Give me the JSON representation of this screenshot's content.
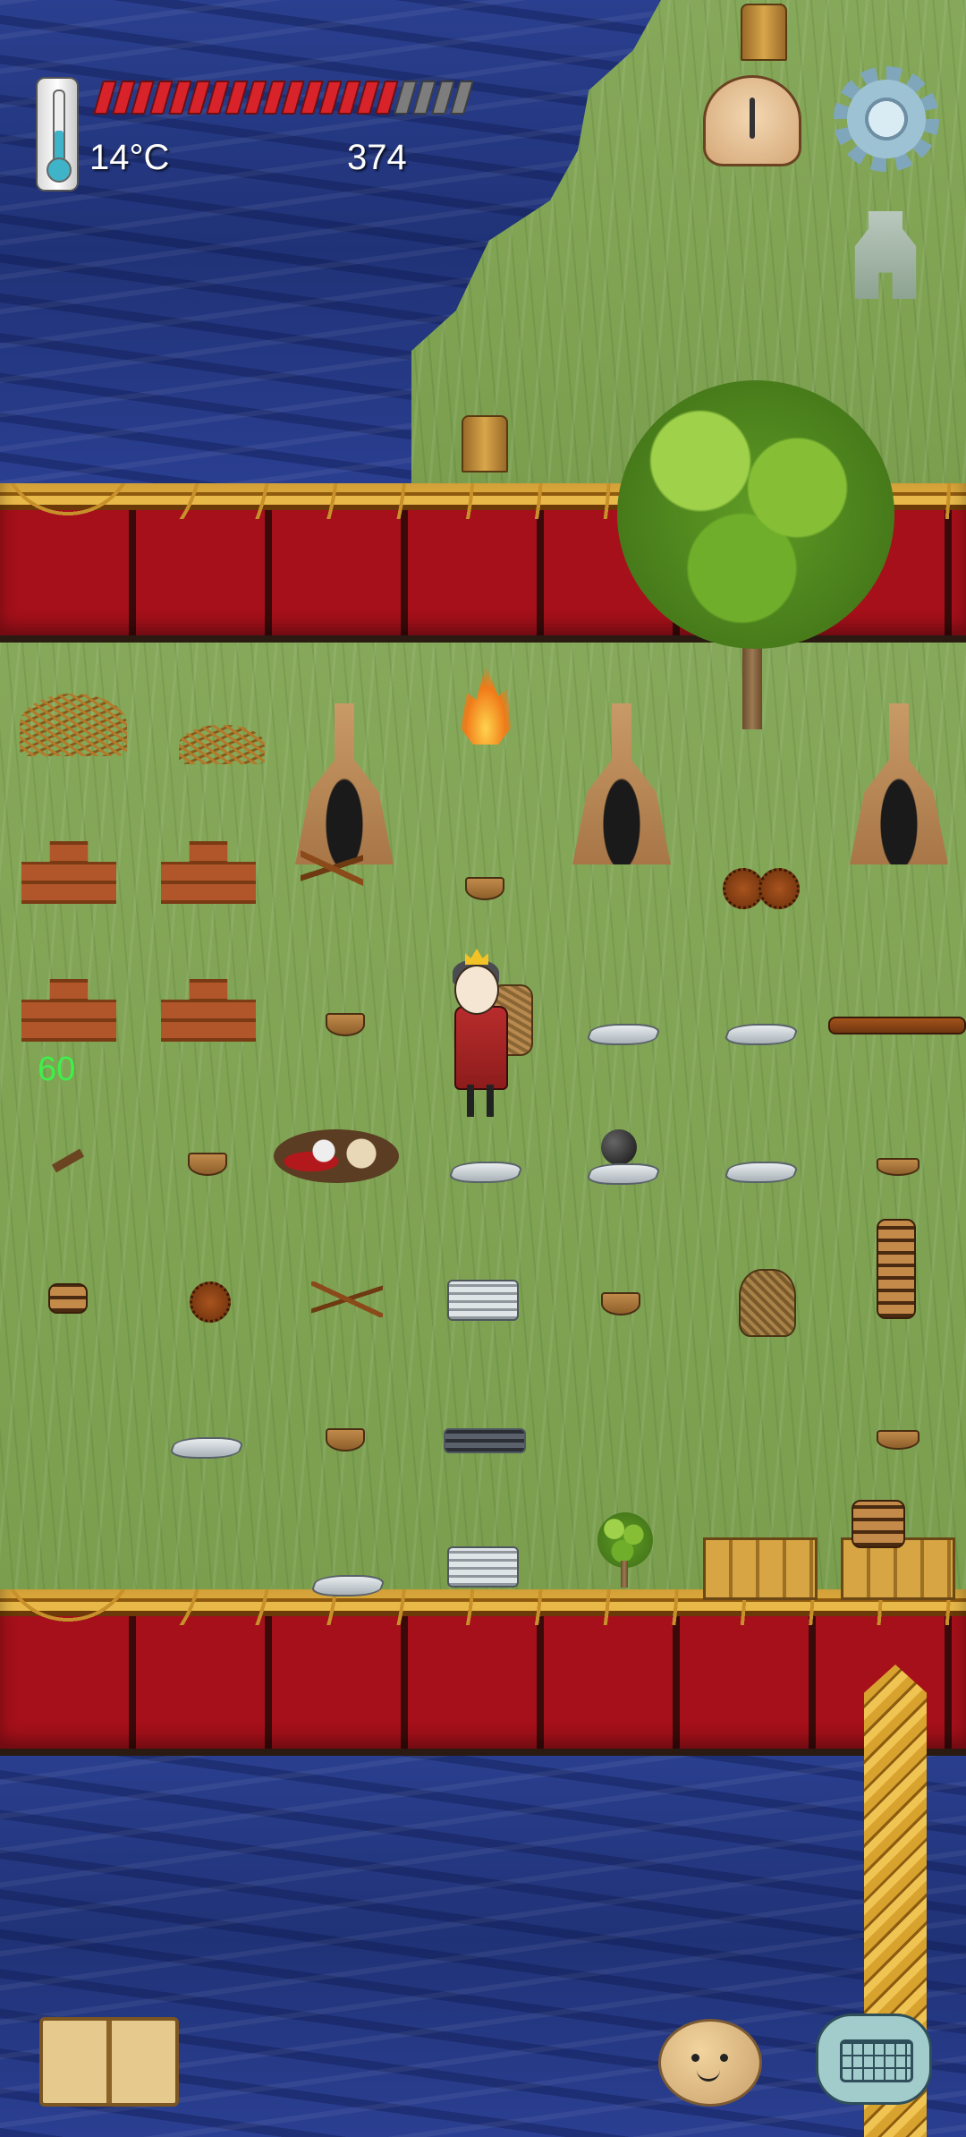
{
  "hud": {
    "temperature": "14°C",
    "food_pips_filled": 16,
    "food_pips_total": 20,
    "yum_score": "374"
  },
  "icons": {
    "thermometer": "thermometer-icon",
    "settings": "gear-icon",
    "clock": "time-clock-icon",
    "tech": "tech-tree-icon",
    "book": "book-icon",
    "emote": "potato-emote-icon",
    "keyboard": "keyboard-chat-icon"
  },
  "world": {
    "floating_number": "60"
  },
  "colors": {
    "water": "#27367f",
    "grass": "#7fa252",
    "wall_red": "#a0141d",
    "wall_gold": "#d9a63a",
    "food_bar": "#d9232b",
    "float_number": "#3df04a"
  }
}
